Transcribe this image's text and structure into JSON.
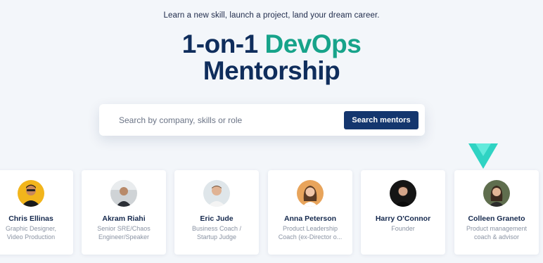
{
  "hero": {
    "tagline": "Learn a new skill, launch a project, land your dream career.",
    "title_accent_before": "1-on-1 ",
    "title_accent": "DevOps",
    "title_line2": "Mentorship"
  },
  "search": {
    "placeholder": "Search by company, skills or role",
    "button_label": "Search mentors"
  },
  "colors": {
    "accent": "#17a38a",
    "primary": "#14366e",
    "headline": "#0f2d5c",
    "decor_triangle": "#2fd3c3"
  },
  "mentors": [
    {
      "name": "Chris Ellinas",
      "role_line1": "Graphic Designer,",
      "role_line2": "Video Production",
      "avatar_icon": "person-photo-yellow-bg"
    },
    {
      "name": "Akram Riahi",
      "role_line1": "Senior SRE/Chaos",
      "role_line2": "Engineer/Speaker",
      "avatar_icon": "person-photo-gray-bg"
    },
    {
      "name": "Eric Jude",
      "role_line1": "Business Coach /",
      "role_line2": "Startup Judge",
      "avatar_icon": "person-photo-light-bg"
    },
    {
      "name": "Anna Peterson",
      "role_line1": "Product Leadership",
      "role_line2": "Coach (ex-Director o...",
      "avatar_icon": "person-photo-orange-bg"
    },
    {
      "name": "Harry O'Connor",
      "role_line1": "Founder",
      "role_line2": "",
      "avatar_icon": "person-photo-dark-bg"
    },
    {
      "name": "Colleen Graneto",
      "role_line1": "Product management",
      "role_line2": "coach & advisor",
      "avatar_icon": "person-photo-green-bg"
    }
  ]
}
